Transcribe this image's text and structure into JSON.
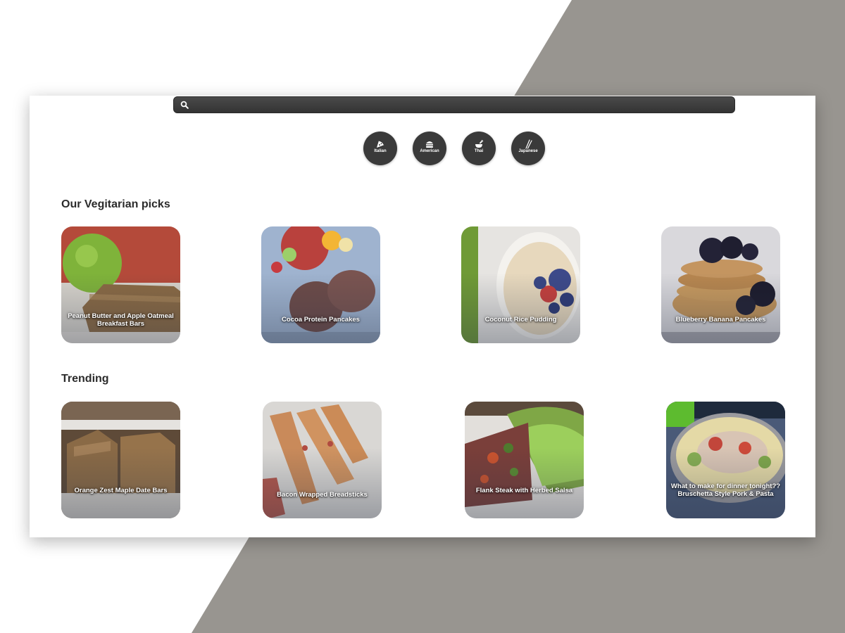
{
  "search": {
    "placeholder": "",
    "icon": "search-icon"
  },
  "cuisines": [
    {
      "label": "Italian",
      "icon": "pizza-icon"
    },
    {
      "label": "American",
      "icon": "burger-icon"
    },
    {
      "label": "Thai",
      "icon": "noodle-bowl-icon"
    },
    {
      "label": "Japanese",
      "icon": "chopsticks-icon"
    }
  ],
  "sections": {
    "vegetarian": {
      "title": "Our Vegitarian picks",
      "cards": [
        {
          "label": "Peanut Butter and Apple Oatmeal Breakfast Bars"
        },
        {
          "label": "Cocoa Protein Pancakes"
        },
        {
          "label": "Coconut Rice Pudding"
        },
        {
          "label": "Blueberry Banana Pancakes"
        }
      ]
    },
    "trending": {
      "title": "Trending",
      "cards": [
        {
          "label": "Orange Zest Maple Date Bars"
        },
        {
          "label": "Bacon Wrapped Breadsticks"
        },
        {
          "label": "Flank Steak with Herbed Salsa"
        },
        {
          "label": "What to make for dinner tonight?? Bruschetta Style Pork & Pasta"
        }
      ]
    }
  },
  "colors": {
    "background_shape": "#989590",
    "search_bar": "#3a3a3a",
    "cuisine_button": "#3a3a3a",
    "heading_text": "#2b2b2b"
  }
}
